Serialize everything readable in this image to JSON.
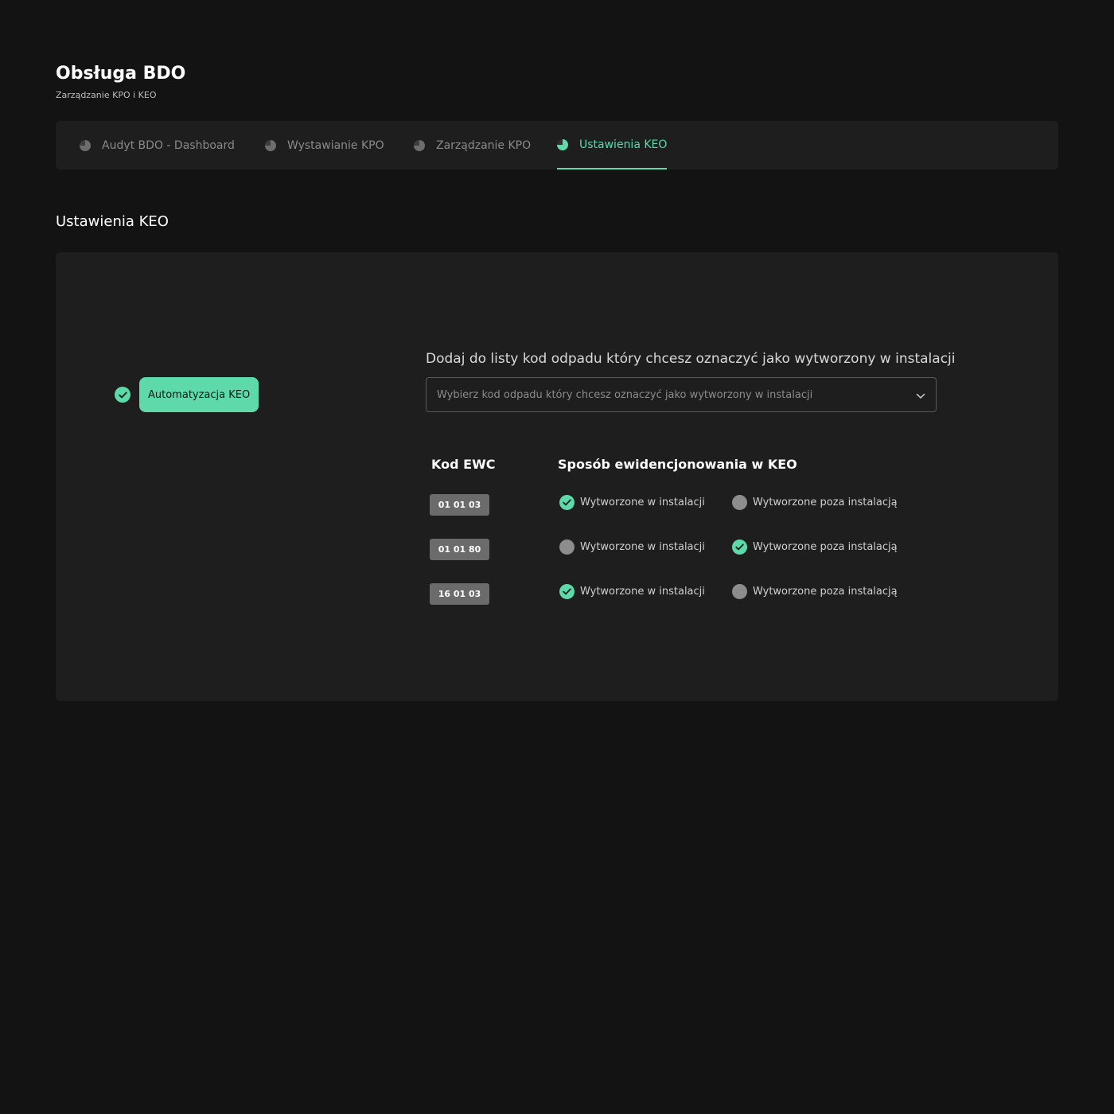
{
  "header": {
    "title": "Obsługa BDO",
    "subtitle": "Zarządzanie KPO i KEO"
  },
  "tabs": [
    {
      "label": "Audyt BDO - Dashboard",
      "active": false
    },
    {
      "label": "Wystawianie KPO",
      "active": false
    },
    {
      "label": "Zarządzanie KPO",
      "active": false
    },
    {
      "label": "Ustawienia KEO",
      "active": true
    }
  ],
  "section": {
    "title": "Ustawienia KEO"
  },
  "automation": {
    "label": "Automatyzacja KEO",
    "enabled": true
  },
  "add_code": {
    "label": "Dodaj do listy kod odpadu który chcesz oznaczyć jako wytworzony w instalacji",
    "placeholder": "Wybierz kod odpadu który chcesz oznaczyć jako wytworzony w instalacji"
  },
  "table": {
    "col_code": "Kod EWC",
    "col_method": "Sposób ewidencjonowania w KEO",
    "option_in": "Wytworzone w instalacji",
    "option_out": "Wytworzone poza instalacją",
    "rows": [
      {
        "code": "01 01 03",
        "selected": "in"
      },
      {
        "code": "01 01 80",
        "selected": "out"
      },
      {
        "code": "16 01 03",
        "selected": "in"
      }
    ]
  },
  "colors": {
    "accent": "#5ed9aa",
    "background": "#131313",
    "panel": "#1e1e1e",
    "radio_inactive": "#8d8d8d",
    "badge": "#6b6b6b"
  },
  "icons": {
    "tab": "pie-chart-icon",
    "checked": "check-circle-icon",
    "unchecked": "radio-empty-icon",
    "select": "chevron-down-icon"
  }
}
